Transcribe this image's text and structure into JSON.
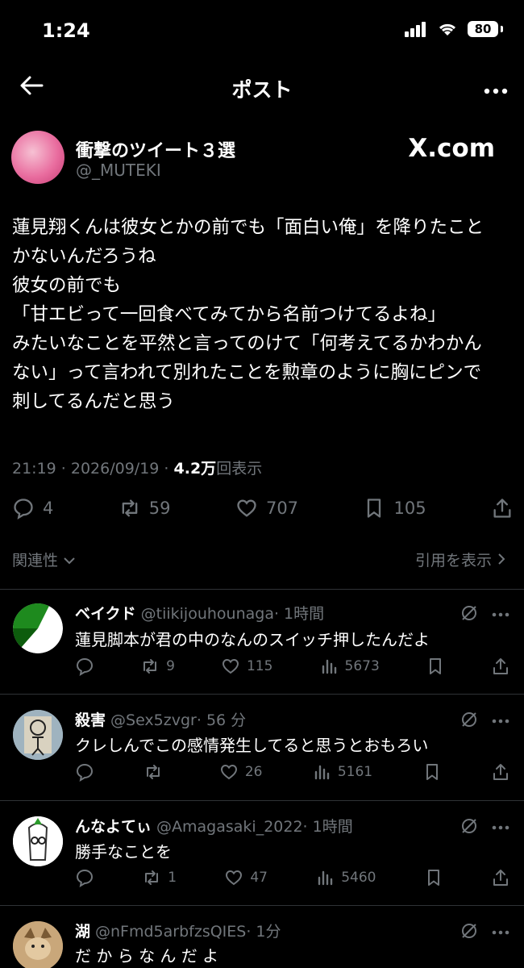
{
  "status_bar": {
    "time": "1:24",
    "battery": "80"
  },
  "header": {
    "title": "ポスト"
  },
  "post": {
    "author_name": "衝撃のツイート３選",
    "author_handle": "@_MUTEKI",
    "watermark": "X.com",
    "text": "蓮見翔くんは彼女とかの前でも「面白い俺」を降りたこと\nかないんだろうね\n彼女の前でも\n「甘エビって一回食べてみてから名前つけてるよね」\nみたいなことを平然と言ってのけて「何考えてるかわかん\nない」って言われて別れたことを勲章のように胸にピンで\n刺してるんだと思う",
    "timestamp": "21:19 · 2026/09/19 · ",
    "views_count": "4.2万",
    "views_label": "回表示",
    "replies": "4",
    "reposts": "59",
    "likes": "707",
    "bookmarks": "105"
  },
  "sections": {
    "related": "関連性",
    "quotes": "引用を表示"
  },
  "replies": [
    {
      "name": "ベイクド",
      "handle": "@tiikijouhounaga",
      "time": "· 1時間",
      "text": "蓮見脚本が君の中のなんのスイッチ押したんだよ",
      "reposts": "9",
      "likes": "115",
      "views": "5673"
    },
    {
      "name": "殺害",
      "handle": "@Sex5zvgr",
      "time": "· 56 分",
      "text": "クレしんでこの感情発生してると思うとおもろい",
      "reposts": "",
      "likes": "26",
      "views": "5161"
    },
    {
      "name": "んなよてぃ",
      "handle": "@Amagasaki_2022",
      "time": "· 1時間",
      "text": "勝手なことを",
      "reposts": "1",
      "likes": "47",
      "views": "5460"
    },
    {
      "name": "湖",
      "handle": "@nFmd5arbfzsQIES",
      "time": "· 1分",
      "text": "だ か ら な ん だ よ"
    }
  ],
  "colors": {
    "background": "#000000",
    "text": "#e7e9ea",
    "muted": "#71767b",
    "divider": "#2f3336"
  }
}
